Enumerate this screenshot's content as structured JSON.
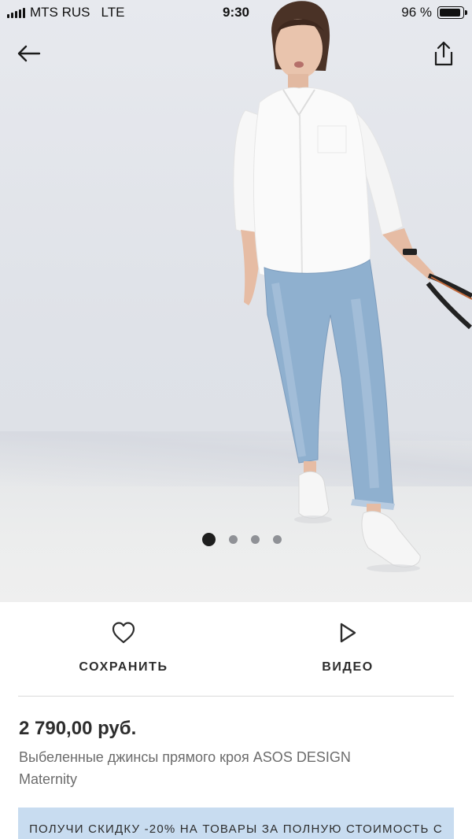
{
  "status_bar": {
    "carrier": "MTS RUS",
    "network": "LTE",
    "time": "9:30",
    "battery_percent": "96 %",
    "battery_level": 0.96
  },
  "header": {
    "back_icon": "arrow-left-icon",
    "share_icon": "share-icon"
  },
  "gallery": {
    "image_count": 4,
    "active_index": 0
  },
  "actions": {
    "save_label": "СОХРАНИТЬ",
    "save_icon": "heart-outline-icon",
    "video_label": "ВИДЕО",
    "video_icon": "play-outline-icon"
  },
  "product": {
    "price": "2 790,00 руб.",
    "name": "Выбеленные джинсы прямого кроя ASOS DESIGN Maternity"
  },
  "promo": {
    "text": "ПОЛУЧИ СКИДКУ -20% НА ТОВАРЫ ЗА ПОЛНУЮ СТОИМОСТЬ С ПРОМОКОДОМ: DODOIT",
    "background": "#c8dcf0"
  }
}
